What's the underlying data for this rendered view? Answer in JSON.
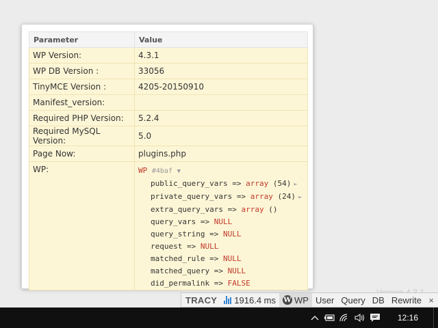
{
  "table": {
    "header": {
      "param": "Parameter",
      "value": "Value"
    },
    "rows": [
      {
        "param": "WP Version:",
        "value": "4.3.1"
      },
      {
        "param": "WP DB Version :",
        "value": "33056"
      },
      {
        "param": "TinyMCE Version :",
        "value": "4205-20150910"
      },
      {
        "param": "Manifest_version:",
        "value": ""
      },
      {
        "param": "Required PHP Version:",
        "value": "5.2.4"
      },
      {
        "param": "Required MySQL Version:",
        "value": "5.0"
      },
      {
        "param": "Page Now:",
        "value": "plugins.php"
      }
    ],
    "wp_label": "WP:"
  },
  "dump": {
    "class": "WP",
    "hash": "#4baf",
    "toggle": "▼",
    "items": [
      {
        "key": "public_query_vars",
        "op": " => ",
        "val": "array",
        "extra": " (54)",
        "expand": "►"
      },
      {
        "key": "private_query_vars",
        "op": " => ",
        "val": "array",
        "extra": " (24)",
        "expand": "►"
      },
      {
        "key": "extra_query_vars",
        "op": " => ",
        "val": "array",
        "extra": " ()",
        "expand": ""
      },
      {
        "key": "query_vars",
        "op": " => ",
        "val": "NULL",
        "extra": "",
        "expand": ""
      },
      {
        "key": "query_string",
        "op": " => ",
        "val": "NULL",
        "extra": "",
        "expand": ""
      },
      {
        "key": "request",
        "op": " => ",
        "val": "NULL",
        "extra": "",
        "expand": ""
      },
      {
        "key": "matched_rule",
        "op": " => ",
        "val": "NULL",
        "extra": "",
        "expand": ""
      },
      {
        "key": "matched_query",
        "op": " => ",
        "val": "NULL",
        "extra": "",
        "expand": ""
      },
      {
        "key": "did_permalink",
        "op": " => ",
        "val": "FALSE",
        "extra": "",
        "expand": ""
      }
    ]
  },
  "background_text": "Version 4.3.1",
  "tracy_bar": {
    "logo": "TRACY",
    "time": "1916.4 ms",
    "wp_label": "WP",
    "panels": [
      "User",
      "Query",
      "DB",
      "Rewrite"
    ],
    "close": "×"
  },
  "taskbar": {
    "clock": "12:16",
    "icons": [
      "chevron-up-icon",
      "battery-icon",
      "wifi-icon",
      "volume-icon",
      "notification-icon"
    ]
  },
  "colors": {
    "row_bg": "#fdf6d6",
    "keyword": "#c0392b",
    "bar_accent": "#3484d2",
    "taskbar": "#101010"
  }
}
